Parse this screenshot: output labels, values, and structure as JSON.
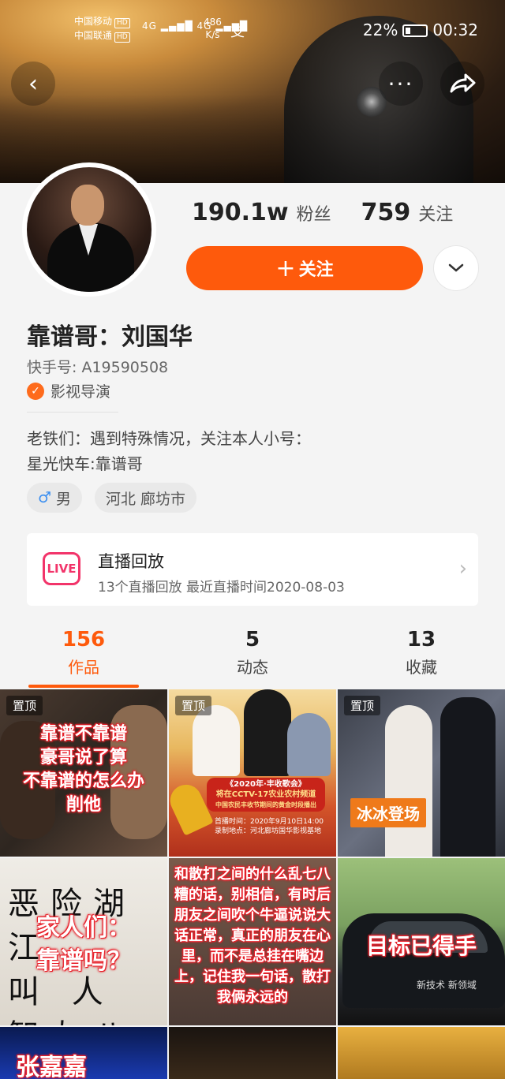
{
  "status_bar": {
    "carrier1": "中国移动",
    "carrier2": "中国联通",
    "hd": "HD",
    "net1": "4G",
    "net2": "4G",
    "speed_value": "486",
    "speed_unit": "K/s",
    "pay_icon": "支",
    "battery_pct": "22%",
    "time": "00:32"
  },
  "header": {
    "back_icon": "chevron-left-icon",
    "more_icon": "ellipsis-icon",
    "share_icon": "share-arrow-icon"
  },
  "profile": {
    "followers_count": "190.1w",
    "followers_label": "粉丝",
    "following_count": "759",
    "following_label": "关注",
    "follow_button": "关注",
    "follow_plus": "+",
    "name": "靠谱哥：刘国华",
    "kuaishou_id": "快手号: A19590508",
    "verified_check": "✓",
    "verified_label": "影视导演",
    "bio_line1": "老铁们：遇到特殊情况，关注本人小号：",
    "bio_line2": "星光快车:靠谱哥",
    "gender_symbol": "♂",
    "gender_label": "男",
    "location": "河北 廊坊市"
  },
  "live_replay": {
    "icon_text": "LIVE",
    "title": "直播回放",
    "subtitle": "13个直播回放 最近直播时间2020-08-03"
  },
  "tabs": [
    {
      "count": "156",
      "label": "作品",
      "active": true
    },
    {
      "count": "5",
      "label": "动态",
      "active": false
    },
    {
      "count": "13",
      "label": "收藏",
      "active": false
    }
  ],
  "grid": {
    "pinned_label": "置顶",
    "cell1_caption": "靠谱不靠谱\n豪哥说了算\n不靠谱的怎么办\n削他",
    "cell2_line1": "《2020年·丰收歌会》",
    "cell2_line2": "将在CCTV-17农业农村频道",
    "cell2_line3": "中国农民丰收节期间的黄金时段播出",
    "cell2_line4": "首播时间：2020年9月10日14:00",
    "cell2_line5": "录制地点：河北廊坊国华影视基地",
    "cell3_caption": "冰冰登场",
    "cell4_calligraphy": "恶险湖江\n叫 人\n智友八大",
    "cell4_caption": "家人们：\n靠谱吗？",
    "cell5_caption": "和散打之间的什么乱七八糟的话，别相信，有时后朋友之间吹个牛逼说说大话正常，真正的朋友在心里，而不是总挂在嘴边上，记住我一句话，散打我俩永远的",
    "cell6_caption": "目标已得手",
    "cell6_car_text": "新技术 新领域",
    "cell7_caption": "张嘉嘉"
  }
}
